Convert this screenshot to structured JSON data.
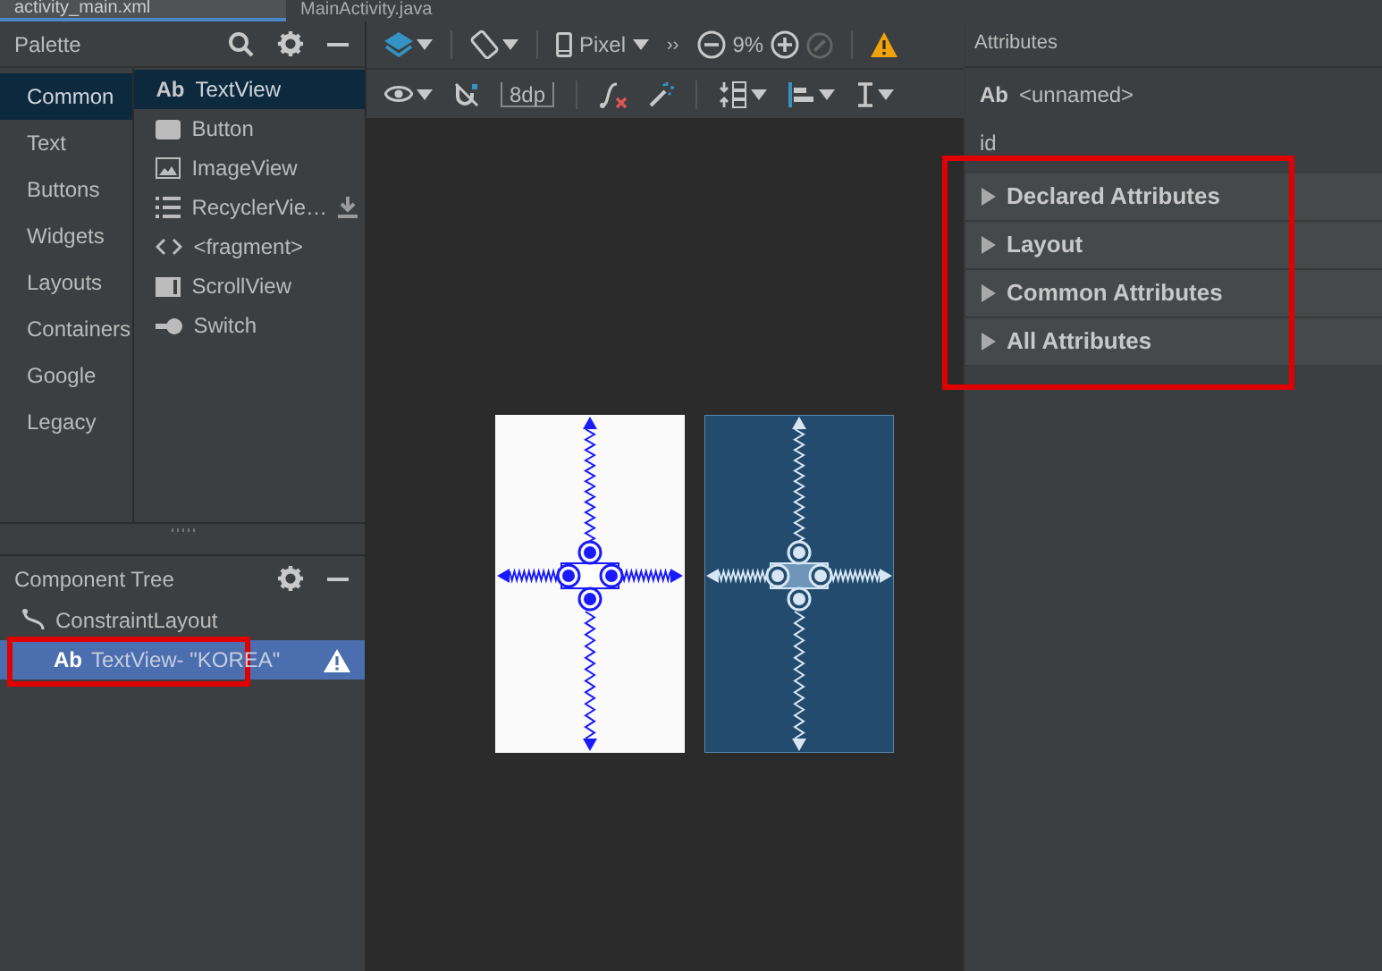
{
  "editor_tabs": [
    {
      "label": "activity_main.xml",
      "selected": true
    },
    {
      "label": "MainActivity.java",
      "selected": false
    }
  ],
  "palette": {
    "title": "Palette",
    "categories": [
      {
        "label": "Common",
        "selected": true
      },
      {
        "label": "Text",
        "selected": false
      },
      {
        "label": "Buttons",
        "selected": false
      },
      {
        "label": "Widgets",
        "selected": false
      },
      {
        "label": "Layouts",
        "selected": false
      },
      {
        "label": "Containers",
        "selected": false
      },
      {
        "label": "Google",
        "selected": false
      },
      {
        "label": "Legacy",
        "selected": false
      }
    ],
    "items": [
      {
        "kind": "text",
        "icon_text": "Ab",
        "label": "TextView",
        "selected": true,
        "downloadable": false
      },
      {
        "kind": "button",
        "label": "Button",
        "selected": false,
        "downloadable": false
      },
      {
        "kind": "image",
        "label": "ImageView",
        "selected": false,
        "downloadable": false
      },
      {
        "kind": "list",
        "label": "RecyclerVie…",
        "selected": false,
        "downloadable": true
      },
      {
        "kind": "fragment",
        "label": "<fragment>",
        "selected": false,
        "downloadable": false
      },
      {
        "kind": "scroll",
        "label": "ScrollView",
        "selected": false,
        "downloadable": false
      },
      {
        "kind": "switch",
        "label": "Switch",
        "selected": false,
        "downloadable": false
      }
    ]
  },
  "toolbar": {
    "device": "Pixel",
    "overflow": "››",
    "zoom": "9%",
    "margin": "8dp"
  },
  "component_tree": {
    "title": "Component Tree",
    "items": [
      {
        "kind": "layout",
        "label": "ConstraintLayout",
        "selected": false,
        "warning": false,
        "highlighted": false,
        "children": [
          {
            "kind": "text",
            "icon_text": "Ab",
            "label": "TextView",
            "detail": "- \"KOREA\"",
            "selected": true,
            "warning": true,
            "highlighted": true
          }
        ]
      }
    ]
  },
  "attributes": {
    "title": "Attributes",
    "component": {
      "icon_text": "Ab",
      "name": "<unnamed>"
    },
    "id_label": "id",
    "sections_highlighted": true,
    "sections": [
      {
        "label": "Declared Attributes",
        "expanded": false
      },
      {
        "label": "Layout",
        "expanded": false
      },
      {
        "label": "Common Attributes",
        "expanded": false
      },
      {
        "label": "All Attributes",
        "expanded": false
      }
    ]
  }
}
